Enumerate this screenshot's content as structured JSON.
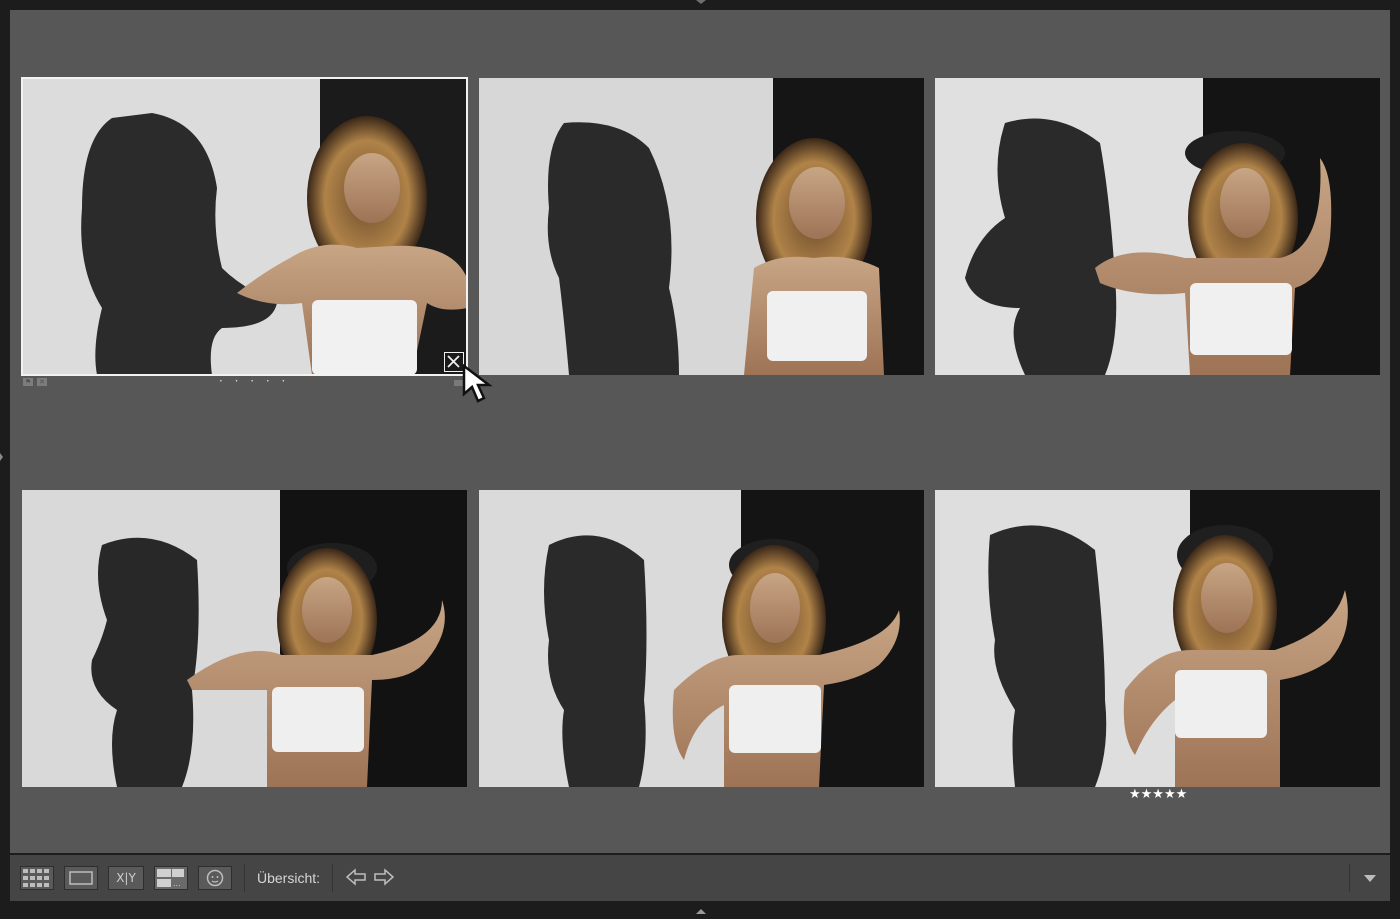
{
  "app": {
    "module": "Library",
    "view_mode": "survey"
  },
  "photos": [
    {
      "id": "photo-1",
      "pose": "hands-on-top",
      "selected": true,
      "flag_state": "none",
      "rating": 0,
      "rating_placeholder": "· · · · ·"
    },
    {
      "id": "photo-2",
      "pose": "arms-down",
      "selected": false,
      "rating": 0
    },
    {
      "id": "photo-3",
      "pose": "hat-raised",
      "selected": false,
      "rating": 0
    },
    {
      "id": "photo-4",
      "pose": "hat-tilted",
      "selected": false,
      "rating": 0
    },
    {
      "id": "photo-5",
      "pose": "hat-hand-hip",
      "selected": false,
      "rating": 0
    },
    {
      "id": "photo-6",
      "pose": "hat-hand-hip-2",
      "selected": false,
      "rating": 5,
      "rating_text": "★★★★★"
    }
  ],
  "toolbar": {
    "grid_view_icon": "grid-icon",
    "loupe_view_icon": "loupe-icon",
    "compare_view_label": "X|Y",
    "survey_view_icon": "survey-icon",
    "people_view_icon": "people-icon",
    "survey_label": "Übersicht:",
    "prev_icon": "arrow-left-icon",
    "next_icon": "arrow-right-icon",
    "menu_icon": "triangle-down-icon"
  },
  "colors": {
    "survey_background": "#575757",
    "toolbar_background": "#454545",
    "selection_border": "#f2f2f2"
  }
}
